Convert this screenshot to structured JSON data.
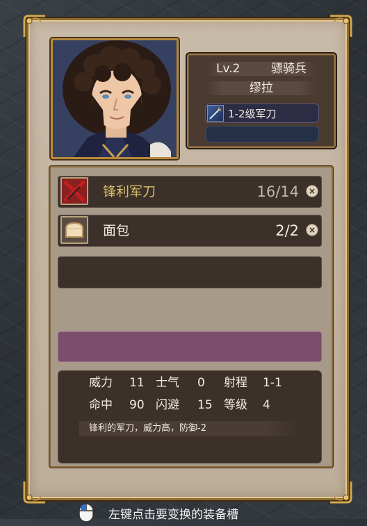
{
  "unit": {
    "level": "Lv.2",
    "class": "骠骑兵",
    "name": "缪拉",
    "equipped_weapon": "1-2级军刀"
  },
  "inventory": [
    {
      "name": "锋利军刀",
      "count": "16/14",
      "name_color": "#d8c06a",
      "count_color": "#bfb7ab",
      "icon": "crossed-sword-icon"
    },
    {
      "name": "面包",
      "count": "2/2",
      "name_color": "#f3ece1",
      "count_color": "#f3ece1",
      "icon": "bread-icon"
    }
  ],
  "stats": {
    "row1": [
      {
        "label": "威力",
        "value": "11"
      },
      {
        "label": "士气",
        "value": "0"
      },
      {
        "label": "射程",
        "value": "1-1"
      }
    ],
    "row2": [
      {
        "label": "命中",
        "value": "90"
      },
      {
        "label": "闪避",
        "value": "15"
      },
      {
        "label": "等级",
        "value": "4"
      }
    ],
    "description": "锋利的军刀，威力高，防御-2"
  },
  "hint": {
    "icon": "mouse-left-click-icon",
    "text": "左键点击要变换的装备槽"
  },
  "colors": {
    "highlight_slot": "#7b4f6c",
    "panel_bg": "#c3b4a1",
    "gold_border": "#b48a3e"
  }
}
